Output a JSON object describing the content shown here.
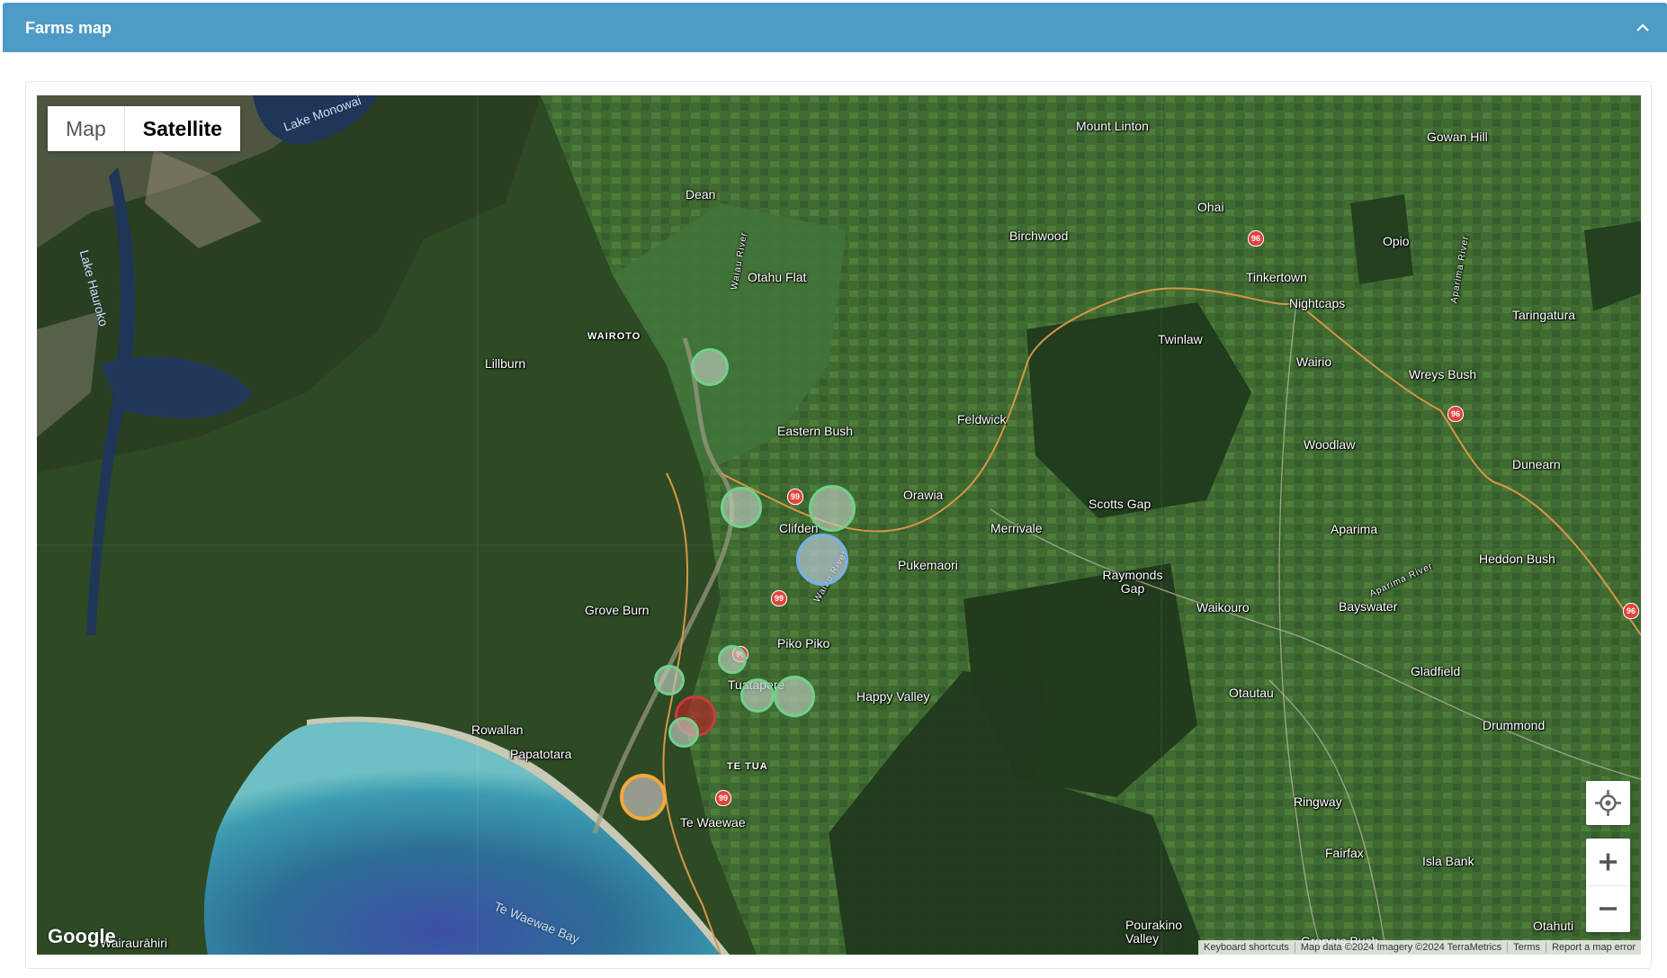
{
  "header": {
    "title": "Farms map"
  },
  "map": {
    "type_buttons": {
      "map": "Map",
      "satellite": "Satellite"
    },
    "selected_type": "Satellite",
    "places": [
      "Lake Monowai",
      "Lake Hauroko",
      "Mount Linton",
      "Gowan Hill",
      "Dean",
      "Ohai",
      "Birchwood",
      "Opio",
      "Otahu Flat",
      "Tinkertown",
      "Nightcaps",
      "Taringatura",
      "Waiau River",
      "Aparima River",
      "WAIROTO",
      "Lillburn",
      "Twinlaw",
      "Wairio",
      "Wreys Bush",
      "Feldwick",
      "Eastern Bush",
      "Woodlaw",
      "Dunearn",
      "Orawia",
      "Clifden",
      "Merrivale",
      "Scotts Gap",
      "Aparima",
      "Pukemaori",
      "Raymonds Gap",
      "Heddon Bush",
      "Waiau River",
      "Grove Burn",
      "Waikouro",
      "Bayswater",
      "Piko Piko",
      "Aparima River",
      "Gladfield",
      "Tuatapere",
      "Happy Valley",
      "Otautau",
      "Rowallan",
      "Drummond",
      "Papatotara",
      "TE TUA",
      "Ringway",
      "Te Waewae",
      "Fairfax",
      "Isla Bank",
      "Te Waewae Bay",
      "Pourakino Valley",
      "Otahuti",
      "Gropers Bush",
      "Wairaurāhiri"
    ],
    "highway_shields": [
      "96",
      "96",
      "96",
      "99",
      "99",
      "99",
      "99"
    ],
    "markers": [
      {
        "status": "green"
      },
      {
        "status": "green"
      },
      {
        "status": "green"
      },
      {
        "status": "blue"
      },
      {
        "status": "green"
      },
      {
        "status": "green"
      },
      {
        "status": "green"
      },
      {
        "status": "green"
      },
      {
        "status": "red"
      },
      {
        "status": "green"
      },
      {
        "status": "orange"
      }
    ],
    "logo": "Google",
    "attribution": {
      "shortcuts": "Keyboard shortcuts",
      "data": "Map data ©2024 Imagery ©2024 TerraMetrics",
      "terms": "Terms",
      "report": "Report a map error"
    }
  },
  "colors": {
    "header": "#4d9bc6",
    "marker_green": "#6fd28a",
    "marker_blue": "#74b1ea",
    "marker_red": "#c73b3b",
    "marker_orange": "#f3a83a"
  }
}
